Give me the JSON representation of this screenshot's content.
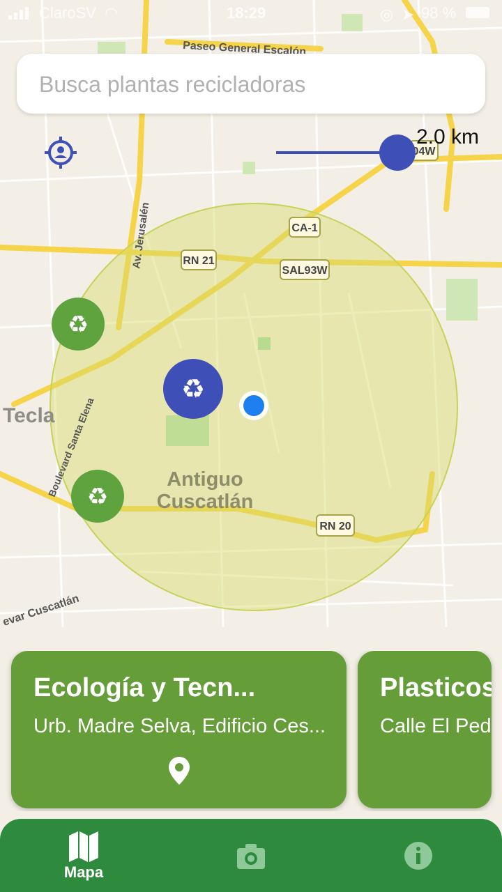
{
  "status_bar": {
    "carrier": "ClaroSV",
    "time": "18:29",
    "battery": "98 %"
  },
  "map": {
    "labels": {
      "paseo": "Paseo General Escalón",
      "jerusalen": "Av. Jerusalén",
      "santa_elena": "Boulevard Santa Elena",
      "tecla": "Tecla",
      "antiguo_line1": "Antiguo",
      "antiguo_line2": "Cuscatlán",
      "cuscatlan_blvd": "evar Cuscatlán"
    },
    "shields": {
      "ca1": "CA-1",
      "rn21": "RN 21",
      "sal93w": "SAL93W",
      "rn20": "RN 20",
      "top_right": "04W"
    },
    "radius_label": "2.0 km",
    "colors": {
      "radius_fill": "#d7dc6a",
      "marker_selected": "#3f4fb8",
      "marker_default": "#5ea33e",
      "user_dot": "#1d7ff0"
    }
  },
  "search": {
    "placeholder": "Busca plantas recicladoras"
  },
  "cards": [
    {
      "title": "Ecología y Tecn...",
      "address": "Urb. Madre Selva, Edificio Ces..."
    },
    {
      "title": "Plasticos",
      "address": "Calle El Pedr"
    }
  ],
  "nav": {
    "tabs": [
      {
        "label": "Mapa",
        "icon": "map-icon",
        "active": true
      },
      {
        "label": "",
        "icon": "camera-icon",
        "active": false
      },
      {
        "label": "",
        "icon": "info-icon",
        "active": false
      }
    ]
  }
}
